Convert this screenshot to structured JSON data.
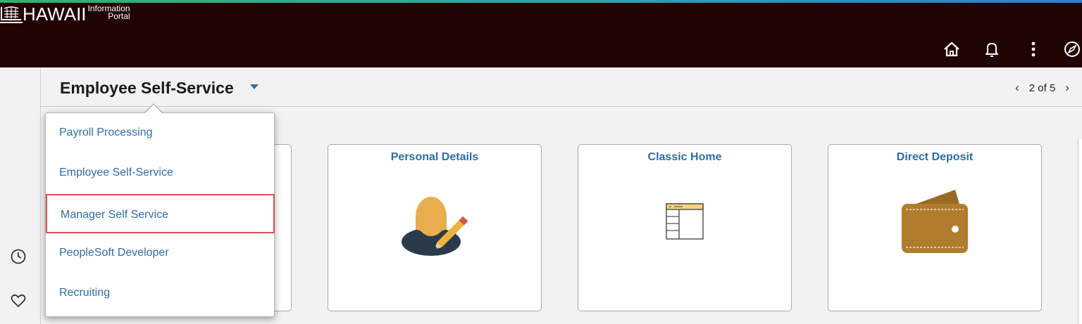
{
  "header": {
    "logo_word": "HAWAII",
    "logo_sub_line1": "Information",
    "logo_sub_line2": "Portal",
    "icons": [
      "home-icon",
      "bell-icon",
      "more-vertical-icon",
      "compass-icon"
    ]
  },
  "titlebar": {
    "title": "Employee Self-Service",
    "pager_text": "2 of 5",
    "prev": "‹",
    "next": "›"
  },
  "dropdown": {
    "items": [
      {
        "label": "Payroll Processing",
        "selected": false
      },
      {
        "label": "Employee Self-Service",
        "selected": false
      },
      {
        "label": "Manager Self Service",
        "selected": true
      },
      {
        "label": "PeopleSoft Developer",
        "selected": false
      },
      {
        "label": "Recruiting",
        "selected": false
      }
    ]
  },
  "tiles": [
    {
      "title": "Personal Details",
      "icon": "person-edit-icon"
    },
    {
      "title": "Classic Home",
      "icon": "classic-home-icon"
    },
    {
      "title": "Direct Deposit",
      "icon": "wallet-icon"
    }
  ],
  "rail": {
    "icons": [
      "recent-history-icon",
      "favorites-heart-icon"
    ]
  },
  "colors": {
    "header_bg": "#210304",
    "link_blue": "#2d6ea8",
    "selected_border": "#d9534f"
  }
}
